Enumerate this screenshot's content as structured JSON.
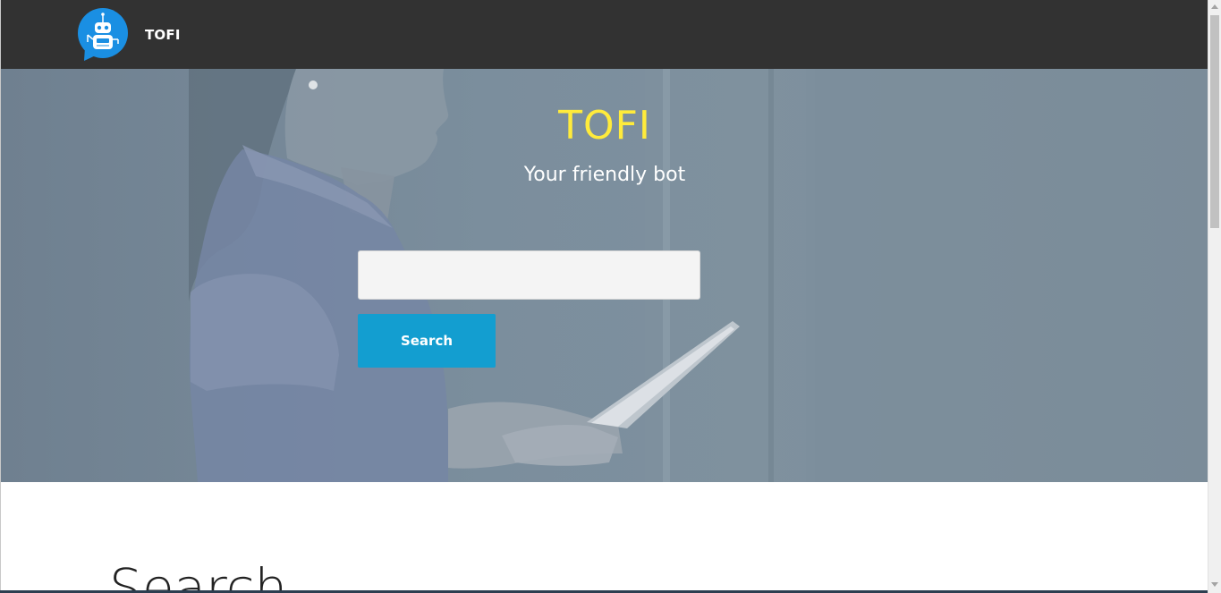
{
  "navbar": {
    "brand_name": "TOFI",
    "logo_icon": "robot-chat-icon"
  },
  "hero": {
    "title": "TOFI",
    "subtitle": "Your friendly bot",
    "search": {
      "value": "",
      "placeholder": ""
    },
    "search_button_label": "Search"
  },
  "section": {
    "heading": "Search"
  },
  "colors": {
    "navbar_bg": "#323232",
    "title_yellow": "#ffeb3b",
    "button_blue": "#139ed0",
    "logo_blue": "#1a8fe3"
  }
}
